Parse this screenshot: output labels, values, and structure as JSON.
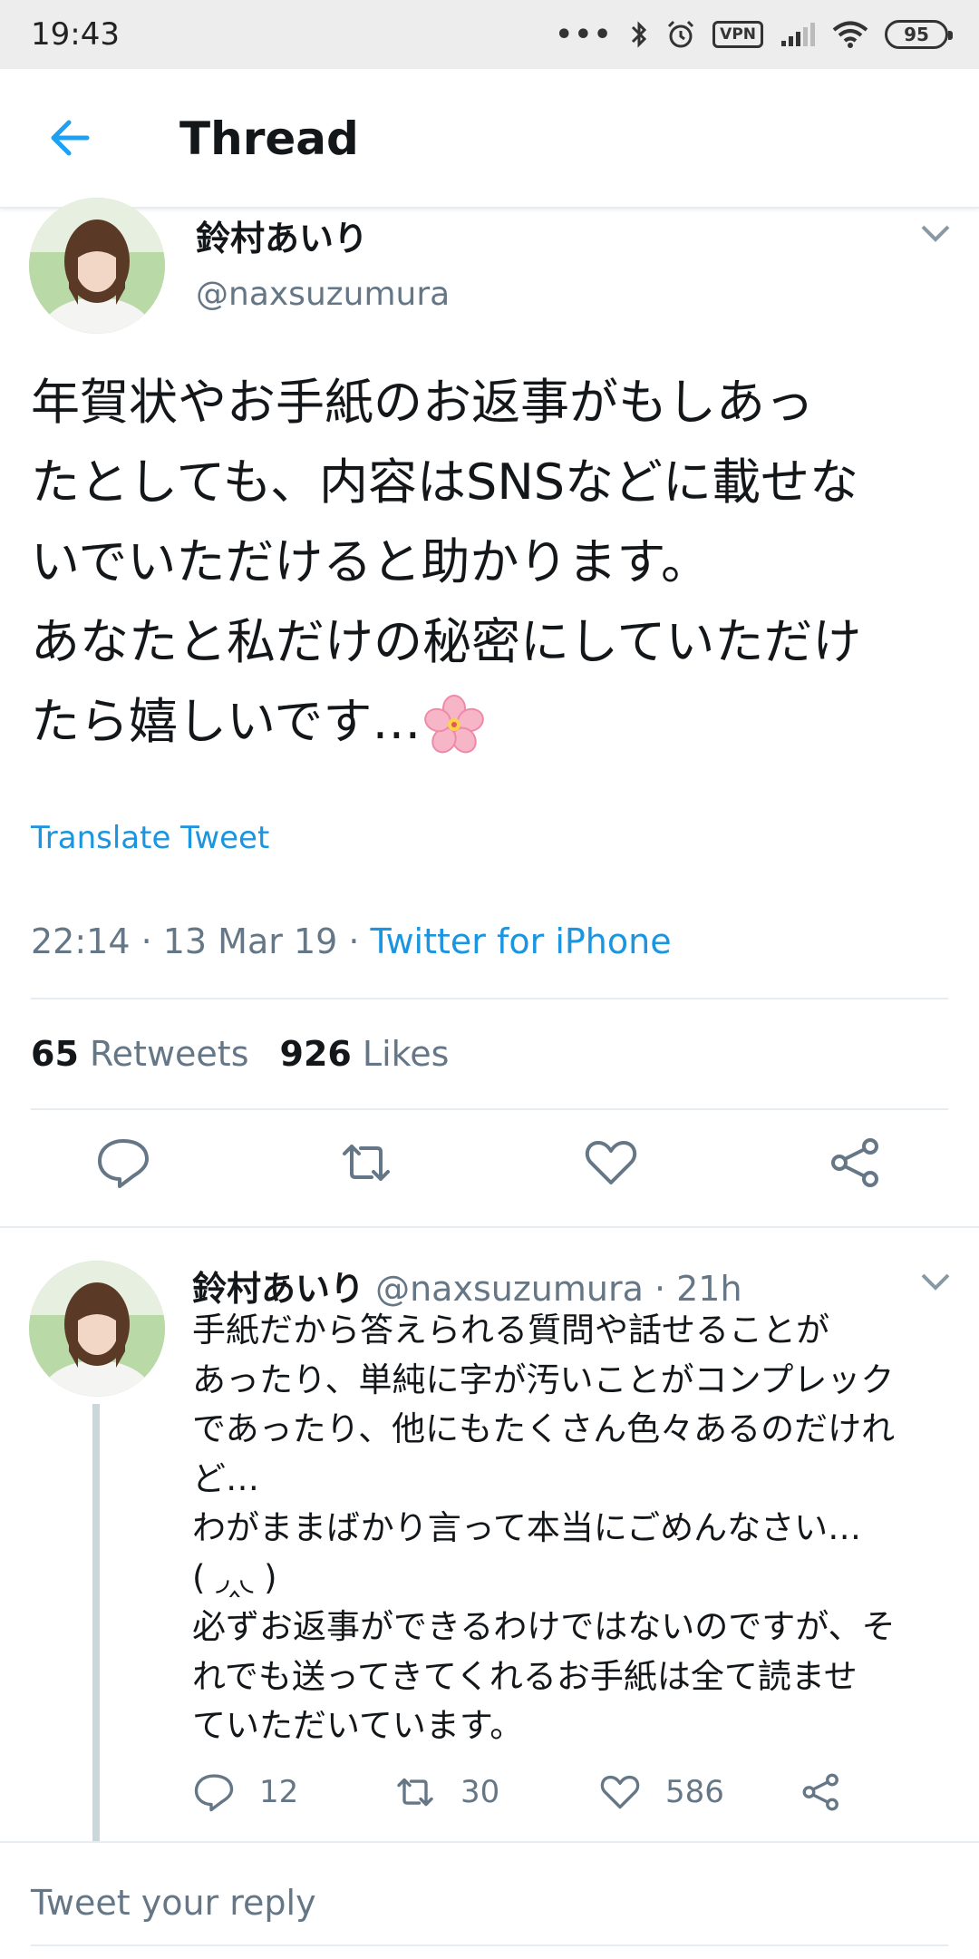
{
  "status_bar": {
    "time": "19:43",
    "icons": [
      "more-dots-icon",
      "bluetooth-icon",
      "alarm-icon",
      "vpn-icon",
      "signal-icon",
      "wifi-icon",
      "battery-icon"
    ],
    "vpn_label": "VPN",
    "battery": "95"
  },
  "app_bar": {
    "back_icon": "back-arrow-icon",
    "title": "Thread"
  },
  "main_tweet": {
    "name": "鈴村あいり",
    "handle": "@naxsuzumura",
    "text": "年賀状やお手紙のお返事がもしあっ\nたとしても、内容はSNSなどに載せな\nいでいただけると助かります。\nあなたと私だけの秘密にしていただけ\nたら嬉しいです…",
    "emoji": "cherry-blossom-icon",
    "translate": "Translate Tweet",
    "time": "22:14 · 13 Mar 19 · ",
    "source": "Twitter for iPhone",
    "retweets_count": "65",
    "retweets_label": "Retweets",
    "likes_count": "926",
    "likes_label": "Likes"
  },
  "reply_tweet": {
    "name": "鈴村あいり",
    "handle_time": " @naxsuzumura · 21h",
    "text": "手紙だから答えられる質問や話せることが\nあったり、単純に字が汚いことがコンプレック\nであったり、他にもたくさん色々あるのだけれ\nど…\nわがままばかり言って本当にごめんなさい…\n( ◞‸◟ )\n必ずお返事ができるわけではないのですが、そ\nれでも送ってきてくれるお手紙は全て読ませ\nていただいています。",
    "reply_count": "12",
    "retweet_count": "30",
    "like_count": "586"
  },
  "reply_box": {
    "placeholder": "Tweet your reply"
  },
  "colors": {
    "accent": "#1da1f2",
    "link": "#1b95e0",
    "secondary_text": "#657786",
    "divider": "#e6ecf0"
  }
}
